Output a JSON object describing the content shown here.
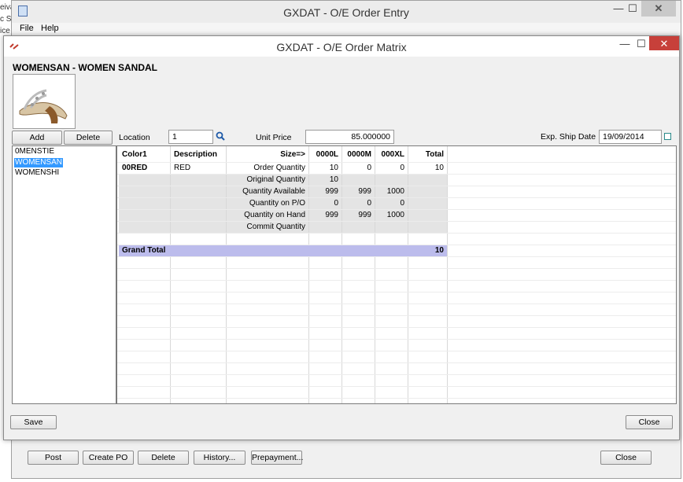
{
  "background_fragments": [
    "eiva",
    "c Se",
    "ice"
  ],
  "outer_window": {
    "title": "GXDAT - O/E Order Entry",
    "controls": {
      "minimize": "—",
      "maximize": "☐",
      "close": "✕"
    },
    "menu": [
      "File",
      "Help"
    ],
    "buttons": {
      "post": "Post",
      "create_po": "Create PO",
      "delete": "Delete",
      "history": "History...",
      "prepayment": "Prepayment...",
      "close": "Close"
    }
  },
  "matrix_window": {
    "title": "GXDAT - O/E Order Matrix",
    "controls": {
      "minimize": "—",
      "maximize": "☐",
      "close": "✕"
    },
    "item_heading": "WOMENSAN - WOMEN SANDAL",
    "add_label": "Add",
    "delete_label": "Delete",
    "location_label": "Location",
    "location_value": "1",
    "unit_price_label": "Unit Price",
    "unit_price_value": "85.000000",
    "ship_date_label": "Exp. Ship Date",
    "ship_date_value": "19/09/2014",
    "items": [
      "0MENSTIE",
      "WOMENSAN",
      "WOMENSHI"
    ],
    "selected_item": "WOMENSAN",
    "grid": {
      "headers": [
        "Color1",
        "Description",
        "Size=>",
        "0000L",
        "0000M",
        "000XL",
        "Total"
      ],
      "color_code": "00RED",
      "color_desc": "RED",
      "rows": [
        {
          "label": "Order Quantity",
          "values": [
            "10",
            "0",
            "0"
          ],
          "total": "10"
        },
        {
          "label": "Original Quantity",
          "values": [
            "10",
            "",
            ""
          ],
          "total": ""
        },
        {
          "label": "Quantity Available",
          "values": [
            "999",
            "999",
            "1000"
          ],
          "total": ""
        },
        {
          "label": "Quantity on P/O",
          "values": [
            "0",
            "0",
            "0"
          ],
          "total": ""
        },
        {
          "label": "Quantity on Hand",
          "values": [
            "999",
            "999",
            "1000"
          ],
          "total": ""
        },
        {
          "label": "Commit Quantity",
          "values": [
            "",
            "",
            ""
          ],
          "total": ""
        }
      ],
      "grand_total_label": "Grand Total",
      "grand_total_value": "10"
    },
    "save_label": "Save",
    "close_label": "Close"
  }
}
